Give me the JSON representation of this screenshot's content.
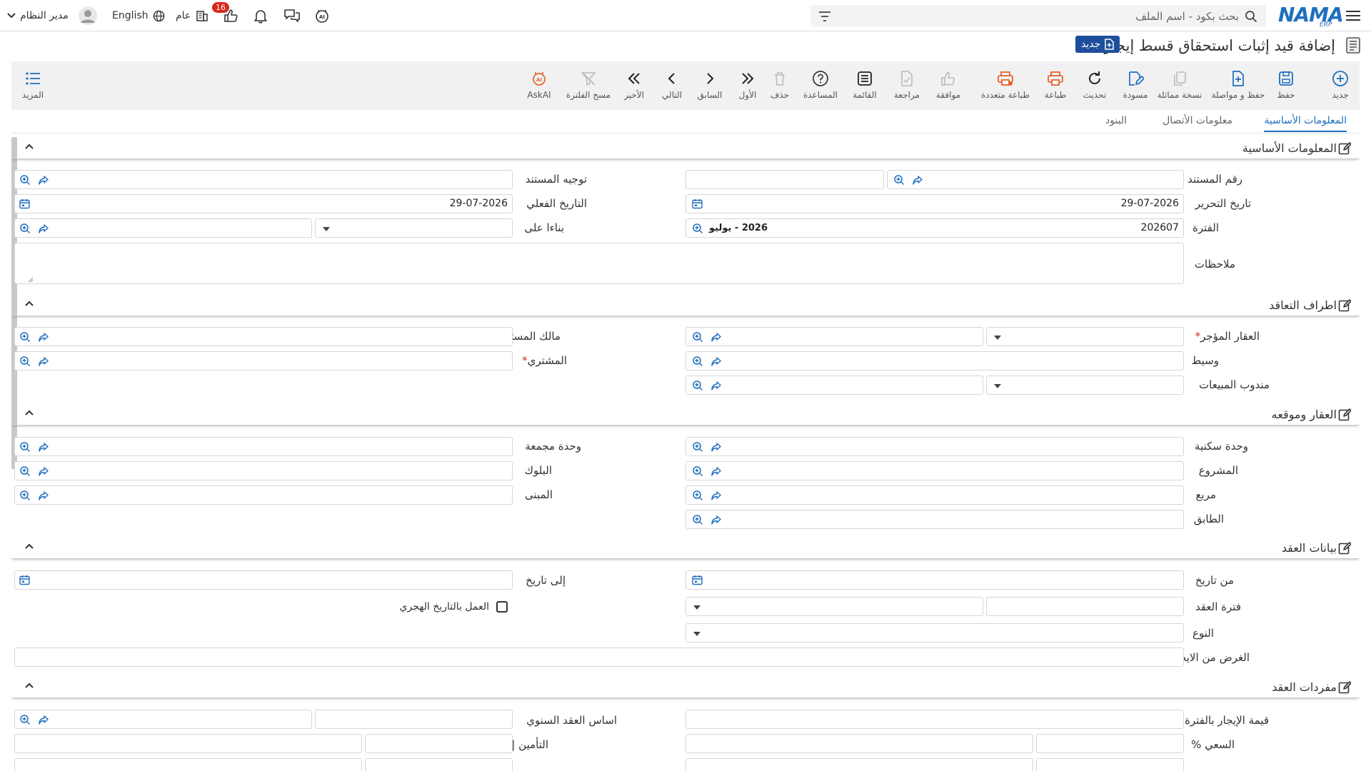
{
  "topbar": {
    "user_name": "مدير النظام",
    "language": "English",
    "notifications_count": "16",
    "general_label": "عام",
    "search_placeholder": "بحث بكود - اسم الملف",
    "logo_text": "NAMA",
    "logo_sub": "ERP"
  },
  "title": {
    "text": "إضافة قيد إثبات استحقاق قسط إيجار",
    "badge": "جديد"
  },
  "toolbar": {
    "more": "المزيد",
    "askai": "AskAI",
    "clear_filter": "مسح الفلترة",
    "last": "الأخير",
    "next": "التالي",
    "previous": "السابق",
    "first": "الأول",
    "delete": "حذف",
    "help": "المساعدة",
    "list": "القائمة",
    "review": "مراجعة",
    "approve": "موافقة",
    "multi_print": "طباعة متعددة",
    "print": "طباعة",
    "refresh": "تحديث",
    "draft": "مسودة",
    "copy": "نسخة مماثلة",
    "save_continue": "حفظ و مواصلة",
    "save": "حفظ",
    "new": "جديد"
  },
  "tabs": [
    "المعلومات الأساسية",
    "معلومات الأتصال",
    "البنود"
  ],
  "sections": {
    "basic": {
      "title": "المعلومات الأساسية",
      "doc_number": "رقم المستند",
      "doc_direction": "توجيه المستند",
      "edit_date": "تاريخ التحرير",
      "edit_date_value": "29-07-2026",
      "actual_date": "التاريخ الفعلي",
      "actual_date_value": "29-07-2026",
      "period": "الفترة",
      "period_value": "202607",
      "period_tag": "2026 - يوليو",
      "based_on": "بناءا على",
      "notes": "ملاحظات"
    },
    "parties": {
      "title": "اطراف التعاقد",
      "leased_property": "العقار المؤجر",
      "doc_owner": "مالك المستند",
      "broker": "وسيط",
      "buyer": "المشتري",
      "sales_rep": "مندوب المبيعات"
    },
    "property": {
      "title": "العقار وموقعه",
      "residential_unit": "وحدة سكنية",
      "complex_unit": "وحدة مجمعة",
      "project": "المشروع",
      "block": "البلوك",
      "square": "مربع",
      "building": "المبنى",
      "floor": "الطابق"
    },
    "contract": {
      "title": "بيانات العقد",
      "from_date": "من تاريخ",
      "to_date": "إلى تاريخ",
      "contract_period": "فترة العقد",
      "hijri": "العمل بالتاريخ الهجري",
      "type": "النوع",
      "lease_purpose": "الغرض من الايجار"
    },
    "items": {
      "title": "مفردات العقد",
      "rent_value": "قيمة الإيجار بالفترة الواحدة",
      "annual_basis": "اساس العقد السنوي",
      "commission": "السعي %",
      "insurance": "التأمين | %"
    }
  },
  "colors": {
    "accent": "#1f6fbf",
    "badge": "#1e4f9c",
    "orange": "#e8622a",
    "required": "#d9281e"
  }
}
